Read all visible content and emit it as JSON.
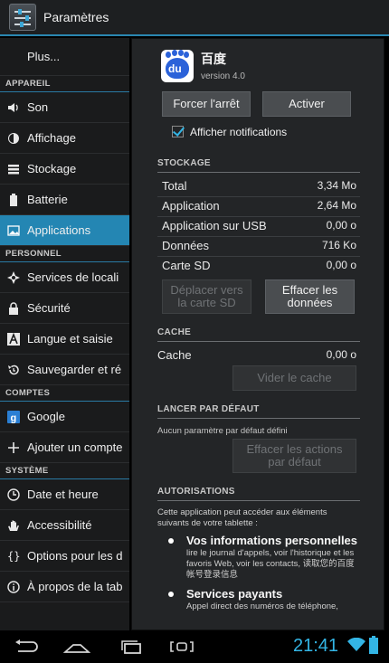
{
  "actionbar": {
    "title": "Paramètres",
    "icon": "settings-icon"
  },
  "sidebar": {
    "more_label": "Plus...",
    "sections": [
      {
        "header": "APPAREIL",
        "items": [
          {
            "label": "Son",
            "icon": "volume-icon"
          },
          {
            "label": "Affichage",
            "icon": "brightness-icon"
          },
          {
            "label": "Stockage",
            "icon": "storage-icon"
          },
          {
            "label": "Batterie",
            "icon": "battery-icon"
          },
          {
            "label": "Applications",
            "icon": "apps-icon",
            "active": true
          }
        ]
      },
      {
        "header": "PERSONNEL",
        "items": [
          {
            "label": "Services de locali",
            "icon": "location-icon"
          },
          {
            "label": "Sécurité",
            "icon": "lock-icon"
          },
          {
            "label": "Langue et saisie",
            "icon": "keyboard-icon"
          },
          {
            "label": "Sauvegarder et ré",
            "icon": "restore-icon"
          }
        ]
      },
      {
        "header": "COMPTES",
        "items": [
          {
            "label": "Google",
            "icon": "google-icon"
          },
          {
            "label": "Ajouter un compte",
            "icon": "plus-icon"
          }
        ]
      },
      {
        "header": "SYSTÈME",
        "items": [
          {
            "label": "Date et heure",
            "icon": "clock-icon"
          },
          {
            "label": "Accessibilité",
            "icon": "hand-icon"
          },
          {
            "label": "Options pour les d",
            "icon": "braces-icon"
          },
          {
            "label": "À propos de la tab",
            "icon": "info-icon"
          }
        ]
      }
    ]
  },
  "app": {
    "name": "百度",
    "version": "version 4.0",
    "icon": "baidu-paw-icon",
    "icon_text": "du",
    "force_stop": "Forcer l'arrêt",
    "enable": "Activer",
    "show_notifications": "Afficher notifications",
    "show_notifications_checked": true
  },
  "storage": {
    "header": "STOCKAGE",
    "rows": [
      {
        "label": "Total",
        "value": "3,34 Mo"
      },
      {
        "label": "Application",
        "value": "2,64 Mo"
      },
      {
        "label": "Application sur USB",
        "value": "0,00 o"
      },
      {
        "label": "Données",
        "value": "716 Ko"
      },
      {
        "label": "Carte SD",
        "value": "0,00 o"
      }
    ],
    "move_button": "Déplacer vers la carte SD",
    "clear_data_button": "Effacer les données"
  },
  "cache": {
    "header": "CACHE",
    "label": "Cache",
    "value": "0,00 o",
    "clear_button": "Vider le cache"
  },
  "defaults": {
    "header": "LANCER PAR DÉFAUT",
    "note": "Aucun paramètre par défaut défini",
    "clear_button": "Effacer les actions par défaut"
  },
  "permissions": {
    "header": "AUTORISATIONS",
    "description": "Cette application peut accéder aux éléments suivants de votre tablette :",
    "items": [
      {
        "title": "Vos informations personnelles",
        "detail": "lire le journal d'appels, voir l'historique et les favoris Web, voir les contacts, 读取您的百度帐号登录信息"
      },
      {
        "title": "Services payants",
        "detail": "Appel direct des numéros de téléphone,"
      }
    ]
  },
  "navbar": {
    "back_icon": "back-icon",
    "home_icon": "home-icon",
    "recents_icon": "recents-icon",
    "screenshot_icon": "screenshot-icon",
    "time": "21:41",
    "wifi_icon": "wifi-icon",
    "battery_icon": "battery-status-icon"
  },
  "colors": {
    "accent": "#33b5e5",
    "active_item": "#2486b3"
  }
}
